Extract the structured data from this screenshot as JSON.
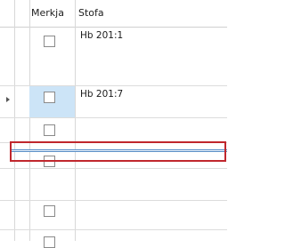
{
  "grid": {
    "columns": [
      {
        "label": "Merkja"
      },
      {
        "label": "Stofa"
      }
    ],
    "rows": [
      {
        "stofa": "Hb 201:1",
        "checked": false
      },
      {
        "stofa": "Hb 201:7",
        "checked": false,
        "selected": true,
        "current": true
      },
      {
        "stofa": "",
        "checked": false
      },
      {
        "stofa": "",
        "checked": false
      },
      {
        "stofa": "",
        "checked": false
      },
      {
        "stofa": "",
        "checked": false
      }
    ]
  },
  "colors": {
    "selection": "#cce4f7",
    "drop_outline": "#c0272d",
    "drop_line": "#5b8fc7",
    "gridline": "#dcdcdc"
  }
}
